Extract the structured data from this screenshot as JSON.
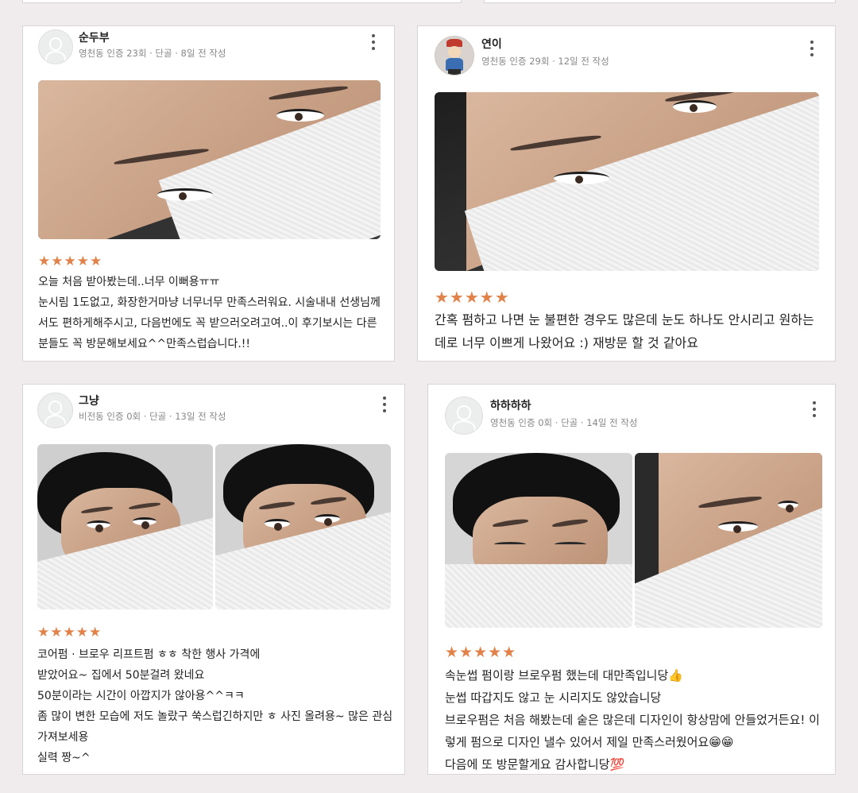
{
  "reviews": [
    {
      "username": "순두부",
      "meta": "영천동 인증 23회 · 단골 · 8일 전 작성",
      "rating": 5,
      "stars": "★★★★★",
      "text": "오늘 처음 받아봤는데..너무 이뻐용ㅠㅠ\n눈시림 1도없고, 화장한거마냥 너무너무 만족스러워요. 시술내내 선생님께서도 편하게해주시고, 다음번에도 꼭 받으러오려고여..이 후기보시는 다른분들도 꼭 방문해보세요^^만족스럽습니다.!!"
    },
    {
      "username": "연이",
      "meta": "영천동 인증 29회 · 12일 전 작성",
      "rating": 5,
      "stars": "★★★★★",
      "text": "간혹 펌하고 나면 눈 불편한 경우도 많은데 눈도 하나도 안시리고 원하는데로 너무 이쁘게 나왔어요 :) 재방문 할 것 같아요"
    },
    {
      "username": "그냥",
      "meta": "비전동 인증 0회 · 단골 · 13일 전 작성",
      "rating": 5,
      "stars": "★★★★★",
      "text": "코어펌  · 브로우 리프트펌 ㅎㅎ 착한 행사 가격에\n받았어요~ 집에서 50분걸려 왔네요\n50분이라는 시간이 아깝지가 않아용^^ㅋㅋ\n좀 많이 변한 모습에 저도 놀랐구 쑥스럽긴하지만 ㅎ 사진 올려용~ 많은 관심 가져보세용\n실력 짱~^"
    },
    {
      "username": "하하하하",
      "meta": "영천동 인증 0회 · 단골 · 14일 전 작성",
      "rating": 5,
      "stars": "★★★★★",
      "text": "속눈썹 펌이랑 브로우펌 했는데 대만족입니당👍\n눈썹 따갑지도 않고 눈 시리지도 않았습니당\n브로우펌은 처음 해봤는데 숱은 많은데 디자인이 항상맘에 안들었거든요! 이렇게 펌으로 디자인 낼수 있어서 제일 만족스러웠어요😁😁\n다음에 또 방문할게요 감사합니당💯"
    }
  ],
  "icons": {
    "avatar_default": "default-profile-icon",
    "avatar_photo": "character-figurine-photo",
    "more": "more-vertical-icon",
    "star": "star-icon"
  },
  "colors": {
    "background": "#f0ebed",
    "star": "#e0824a",
    "meta_text": "#888888"
  }
}
